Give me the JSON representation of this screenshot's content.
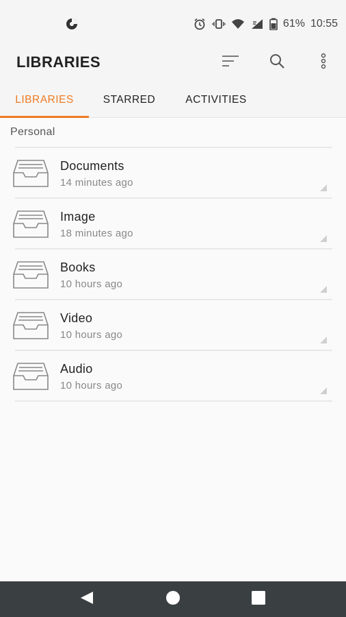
{
  "status_bar": {
    "left_icon": "data-saver-icon",
    "battery_percent": "61%",
    "time": "10:55",
    "icons": [
      "alarm-icon",
      "vibrate-icon",
      "wifi-icon",
      "signal-icon",
      "battery-icon"
    ]
  },
  "app_bar": {
    "title": "LIBRARIES",
    "actions": [
      "sort-icon",
      "search-icon",
      "more-vert-icon"
    ]
  },
  "tabs": [
    {
      "label": "LIBRARIES",
      "active": true
    },
    {
      "label": "STARRED",
      "active": false
    },
    {
      "label": "ACTIVITIES",
      "active": false
    }
  ],
  "section": {
    "label": "Personal"
  },
  "libraries": [
    {
      "name": "Documents",
      "time": "14 minutes ago",
      "icon": "tray-icon"
    },
    {
      "name": "Image",
      "time": "18 minutes ago",
      "icon": "tray-icon"
    },
    {
      "name": "Books",
      "time": "10 hours ago",
      "icon": "tray-icon"
    },
    {
      "name": "Video",
      "time": "10 hours ago",
      "icon": "tray-icon"
    },
    {
      "name": "Audio",
      "time": "10 hours ago",
      "icon": "tray-icon"
    }
  ],
  "nav_bar": {
    "buttons": [
      "back-icon",
      "home-icon",
      "recents-icon"
    ]
  },
  "colors": {
    "accent": "#ee7a23",
    "bar_background": "#f5f5f5",
    "nav_background": "#3a3f42"
  }
}
